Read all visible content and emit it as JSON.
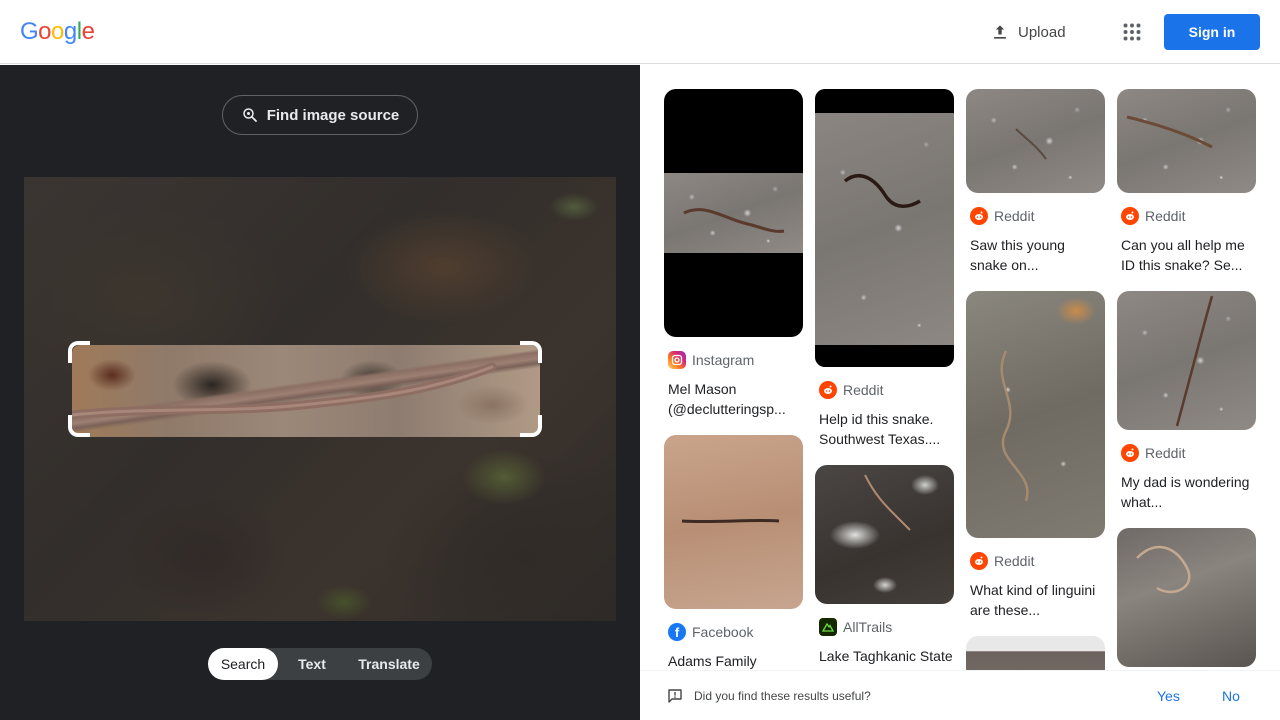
{
  "header": {
    "logo_text": "Google",
    "upload_label": "Upload",
    "signin_label": "Sign in"
  },
  "lens": {
    "find_source_label": "Find image source",
    "tabs": [
      {
        "label": "Search",
        "active": true
      },
      {
        "label": "Text",
        "active": false
      },
      {
        "label": "Translate",
        "active": false
      }
    ]
  },
  "results": [
    {
      "source": "Instagram",
      "caption": "Mel Mason (@declutteringsp..."
    },
    {
      "source": "Reddit",
      "caption": "Help id this snake. Southwest Texas...."
    },
    {
      "source": "Reddit",
      "caption": "Saw this young snake on..."
    },
    {
      "source": "Reddit",
      "caption": "Can you all help me ID this snake? Se..."
    },
    {
      "source": "Facebook",
      "caption": "Adams Family"
    },
    {
      "source": "AllTrails",
      "caption": "Lake Taghkanic State Park Loop"
    },
    {
      "source": "Reddit",
      "caption": "What kind of linguini are these..."
    },
    {
      "source": "Reddit",
      "caption": "My dad is wondering what..."
    }
  ],
  "feedback": {
    "question": "Did you find these results useful?",
    "yes_label": "Yes",
    "no_label": "No"
  },
  "colors": {
    "accent": "#1a73e8",
    "panel_bg": "#202124",
    "reddit": "#ff4500",
    "facebook": "#1877f2",
    "alltrails": "#142800"
  }
}
